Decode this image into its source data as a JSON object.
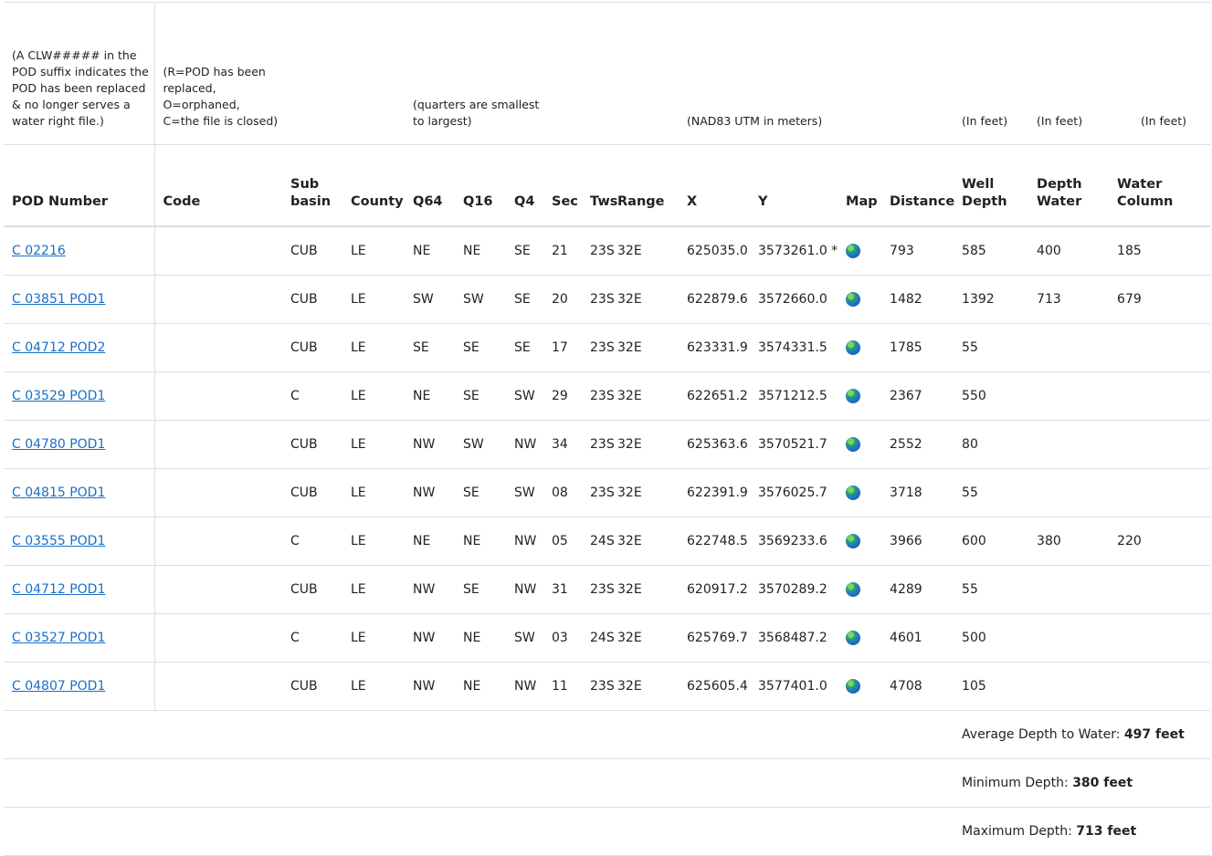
{
  "notes": {
    "pod_number": "(A CLW##### in the POD suffix indicates the POD has been replaced\n& no longer serves a water right file.)",
    "code": "(R=POD has been replaced,\nO=orphaned, C=the file is closed)",
    "quarters": "(quarters are smallest to largest)",
    "utm": "(NAD83 UTM in meters)",
    "well_depth_unit": "(In feet)",
    "depth_water_unit": "(In feet)",
    "water_column_unit": "(In feet)"
  },
  "headers": {
    "pod_number": "POD Number",
    "code": "Code",
    "sub_basin": "Sub basin",
    "county": "County",
    "q64": "Q64",
    "q16": "Q16",
    "q4": "Q4",
    "sec": "Sec",
    "tws": "Tws",
    "range": "Range",
    "x": "X",
    "y": "Y",
    "map": "Map",
    "distance": "Distance",
    "well_depth": "Well Depth",
    "depth_water": "Depth Water",
    "water_column": "Water Column"
  },
  "rows": [
    {
      "pod": "C 02216",
      "code": "",
      "basin": "CUB",
      "county": "LE",
      "q64": "NE",
      "q16": "NE",
      "q4": "SE",
      "sec": "21",
      "tws": "23S",
      "range": "32E",
      "x": "625035.0",
      "y": "3573261.0 *",
      "distance": "793",
      "well_depth": "585",
      "depth_water": "400",
      "water_column": "185"
    },
    {
      "pod": "C 03851 POD1",
      "code": "",
      "basin": "CUB",
      "county": "LE",
      "q64": "SW",
      "q16": "SW",
      "q4": "SE",
      "sec": "20",
      "tws": "23S",
      "range": "32E",
      "x": "622879.6",
      "y": "3572660.0",
      "distance": "1482",
      "well_depth": "1392",
      "depth_water": "713",
      "water_column": "679"
    },
    {
      "pod": "C 04712 POD2",
      "code": "",
      "basin": "CUB",
      "county": "LE",
      "q64": "SE",
      "q16": "SE",
      "q4": "SE",
      "sec": "17",
      "tws": "23S",
      "range": "32E",
      "x": "623331.9",
      "y": "3574331.5",
      "distance": "1785",
      "well_depth": "55",
      "depth_water": "",
      "water_column": ""
    },
    {
      "pod": "C 03529 POD1",
      "code": "",
      "basin": "C",
      "county": "LE",
      "q64": "NE",
      "q16": "SE",
      "q4": "SW",
      "sec": "29",
      "tws": "23S",
      "range": "32E",
      "x": "622651.2",
      "y": "3571212.5",
      "distance": "2367",
      "well_depth": "550",
      "depth_water": "",
      "water_column": ""
    },
    {
      "pod": "C 04780 POD1",
      "code": "",
      "basin": "CUB",
      "county": "LE",
      "q64": "NW",
      "q16": "SW",
      "q4": "NW",
      "sec": "34",
      "tws": "23S",
      "range": "32E",
      "x": "625363.6",
      "y": "3570521.7",
      "distance": "2552",
      "well_depth": "80",
      "depth_water": "",
      "water_column": ""
    },
    {
      "pod": "C 04815 POD1",
      "code": "",
      "basin": "CUB",
      "county": "LE",
      "q64": "NW",
      "q16": "SE",
      "q4": "SW",
      "sec": "08",
      "tws": "23S",
      "range": "32E",
      "x": "622391.9",
      "y": "3576025.7",
      "distance": "3718",
      "well_depth": "55",
      "depth_water": "",
      "water_column": ""
    },
    {
      "pod": "C 03555 POD1",
      "code": "",
      "basin": "C",
      "county": "LE",
      "q64": "NE",
      "q16": "NE",
      "q4": "NW",
      "sec": "05",
      "tws": "24S",
      "range": "32E",
      "x": "622748.5",
      "y": "3569233.6",
      "distance": "3966",
      "well_depth": "600",
      "depth_water": "380",
      "water_column": "220"
    },
    {
      "pod": "C 04712 POD1",
      "code": "",
      "basin": "CUB",
      "county": "LE",
      "q64": "NW",
      "q16": "SE",
      "q4": "NW",
      "sec": "31",
      "tws": "23S",
      "range": "32E",
      "x": "620917.2",
      "y": "3570289.2",
      "distance": "4289",
      "well_depth": "55",
      "depth_water": "",
      "water_column": ""
    },
    {
      "pod": "C 03527 POD1",
      "code": "",
      "basin": "C",
      "county": "LE",
      "q64": "NW",
      "q16": "NE",
      "q4": "SW",
      "sec": "03",
      "tws": "24S",
      "range": "32E",
      "x": "625769.7",
      "y": "3568487.2",
      "distance": "4601",
      "well_depth": "500",
      "depth_water": "",
      "water_column": ""
    },
    {
      "pod": "C 04807 POD1",
      "code": "",
      "basin": "CUB",
      "county": "LE",
      "q64": "NW",
      "q16": "NE",
      "q4": "NW",
      "sec": "11",
      "tws": "23S",
      "range": "32E",
      "x": "625605.4",
      "y": "3577401.0",
      "distance": "4708",
      "well_depth": "105",
      "depth_water": "",
      "water_column": ""
    }
  ],
  "summary": {
    "average_label": "Average Depth to Water: ",
    "average_value": "497 feet",
    "minimum_label": "Minimum Depth: ",
    "minimum_value": "380 feet",
    "maximum_label": "Maximum Depth: ",
    "maximum_value": "713 feet"
  },
  "icons": {
    "map": "globe-icon"
  },
  "colors": {
    "link": "#1a6fc7",
    "border": "#dddddd"
  }
}
